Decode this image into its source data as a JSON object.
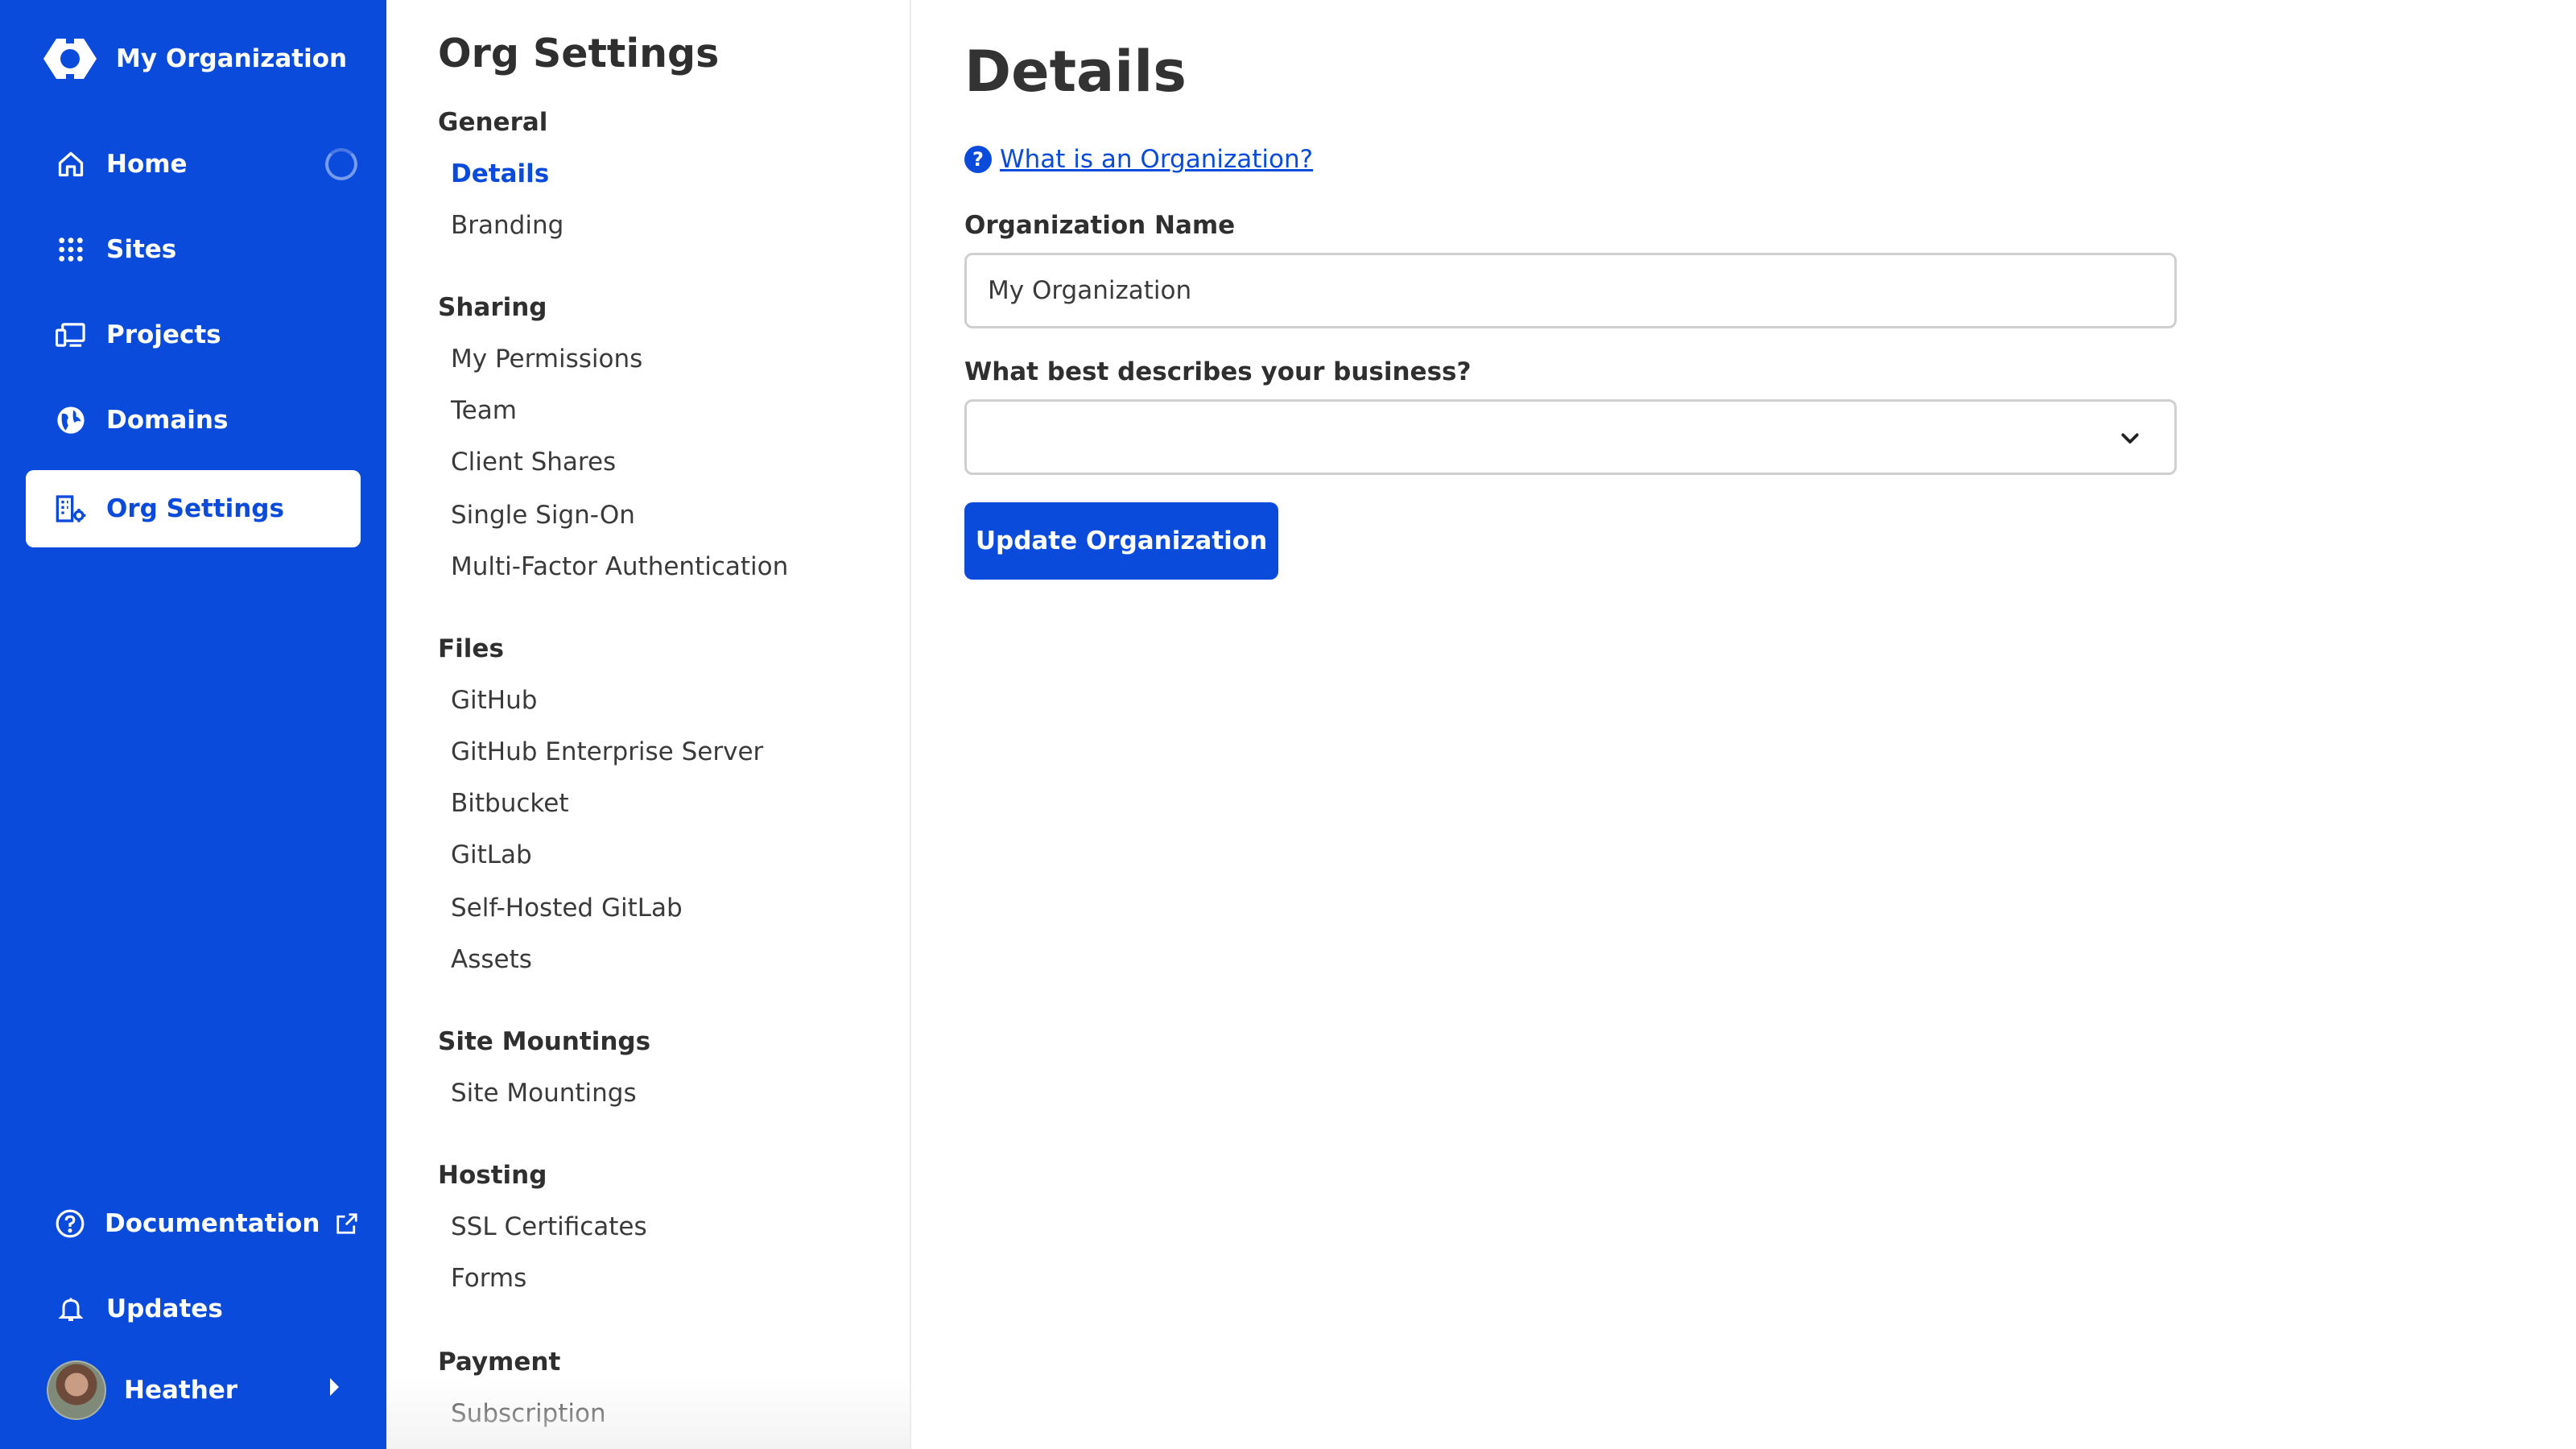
{
  "colors": {
    "brand": "#0a4bdc",
    "text": "#2f2f2f",
    "border": "#cfcfcf"
  },
  "sidebar": {
    "org_name": "My Organization",
    "items": [
      {
        "label": "Home",
        "icon": "home-icon"
      },
      {
        "label": "Sites",
        "icon": "grid-icon"
      },
      {
        "label": "Projects",
        "icon": "devices-icon"
      },
      {
        "label": "Domains",
        "icon": "globe-icon"
      },
      {
        "label": "Org Settings",
        "icon": "building-gear-icon",
        "active": true
      }
    ],
    "bottom_items": [
      {
        "label": "Documentation",
        "icon": "help-circle-icon",
        "external": true
      },
      {
        "label": "Updates",
        "icon": "bell-icon"
      }
    ],
    "user": {
      "name": "Heather"
    }
  },
  "subnav": {
    "title": "Org Settings",
    "sections": [
      {
        "heading": "General",
        "items": [
          "Details",
          "Branding"
        ]
      },
      {
        "heading": "Sharing",
        "items": [
          "My Permissions",
          "Team",
          "Client Shares",
          "Single Sign-On",
          "Multi-Factor Authentication"
        ]
      },
      {
        "heading": "Files",
        "items": [
          "GitHub",
          "GitHub Enterprise Server",
          "Bitbucket",
          "GitLab",
          "Self-Hosted GitLab",
          "Assets"
        ]
      },
      {
        "heading": "Site Mountings",
        "items": [
          "Site Mountings"
        ]
      },
      {
        "heading": "Hosting",
        "items": [
          "SSL Certificates",
          "Forms"
        ]
      },
      {
        "heading": "Payment",
        "items": [
          "Subscription"
        ]
      }
    ],
    "active_item": "Details"
  },
  "main": {
    "title": "Details",
    "help_link": "What is an Organization?",
    "org_name_label": "Organization Name",
    "org_name_value": "My Organization",
    "business_label": "What best describes your business?",
    "business_value": "",
    "submit_label": "Update Organization"
  }
}
